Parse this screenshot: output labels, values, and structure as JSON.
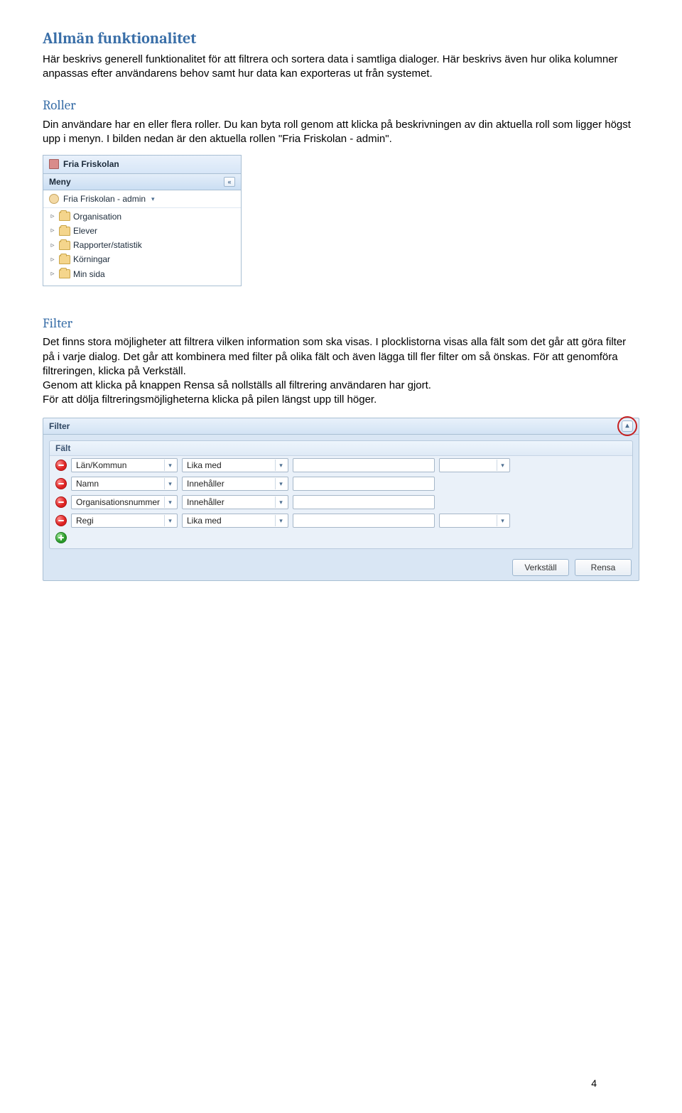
{
  "doc": {
    "h1": "Allmän funktionalitet",
    "p1": "Här beskrivs generell funktionalitet för att filtrera och sortera data i samtliga dialoger. Här beskrivs även hur olika kolumner anpassas efter användarens behov samt hur data kan exporteras ut från systemet.",
    "h2_roller": "Roller",
    "p_roller": "Din användare har en eller flera roller. Du kan byta roll genom att klicka på beskrivningen av din aktuella roll som ligger högst upp i menyn. I bilden nedan är den aktuella rollen \"Fria Friskolan - admin\".",
    "h2_filter": "Filter",
    "p_filter": "Det finns stora möjligheter att filtrera vilken information som ska visas. I plocklistorna visas alla fält som det går att göra filter på i varje dialog. Det går att kombinera med filter på olika fält och även lägga till fler filter om så önskas. För att genomföra filtreringen, klicka på Verkställ.\nGenom att klicka på knappen Rensa så nollställs all filtrering användaren har gjort.\nFör att dölja filtreringsmöjligheterna klicka på pilen längst upp till höger."
  },
  "panel1": {
    "title": "Fria Friskolan",
    "menu_label": "Meny",
    "role_label": "Fria Friskolan - admin",
    "items": [
      {
        "label": "Organisation"
      },
      {
        "label": "Elever"
      },
      {
        "label": "Rapporter/statistik"
      },
      {
        "label": "Körningar"
      },
      {
        "label": "Min sida"
      }
    ]
  },
  "panel2": {
    "title": "Filter",
    "group_title": "Fält",
    "rows": [
      {
        "field": "Län/Kommun",
        "op": "Lika med",
        "value": "",
        "has_combo2": true
      },
      {
        "field": "Namn",
        "op": "Innehåller",
        "value": "",
        "has_combo2": false
      },
      {
        "field": "Organisationsnummer",
        "op": "Innehåller",
        "value": "",
        "has_combo2": false
      },
      {
        "field": "Regi",
        "op": "Lika med",
        "value": "",
        "has_combo2": true
      }
    ],
    "btn_apply": "Verkställ",
    "btn_clear": "Rensa"
  },
  "page_number": "4"
}
